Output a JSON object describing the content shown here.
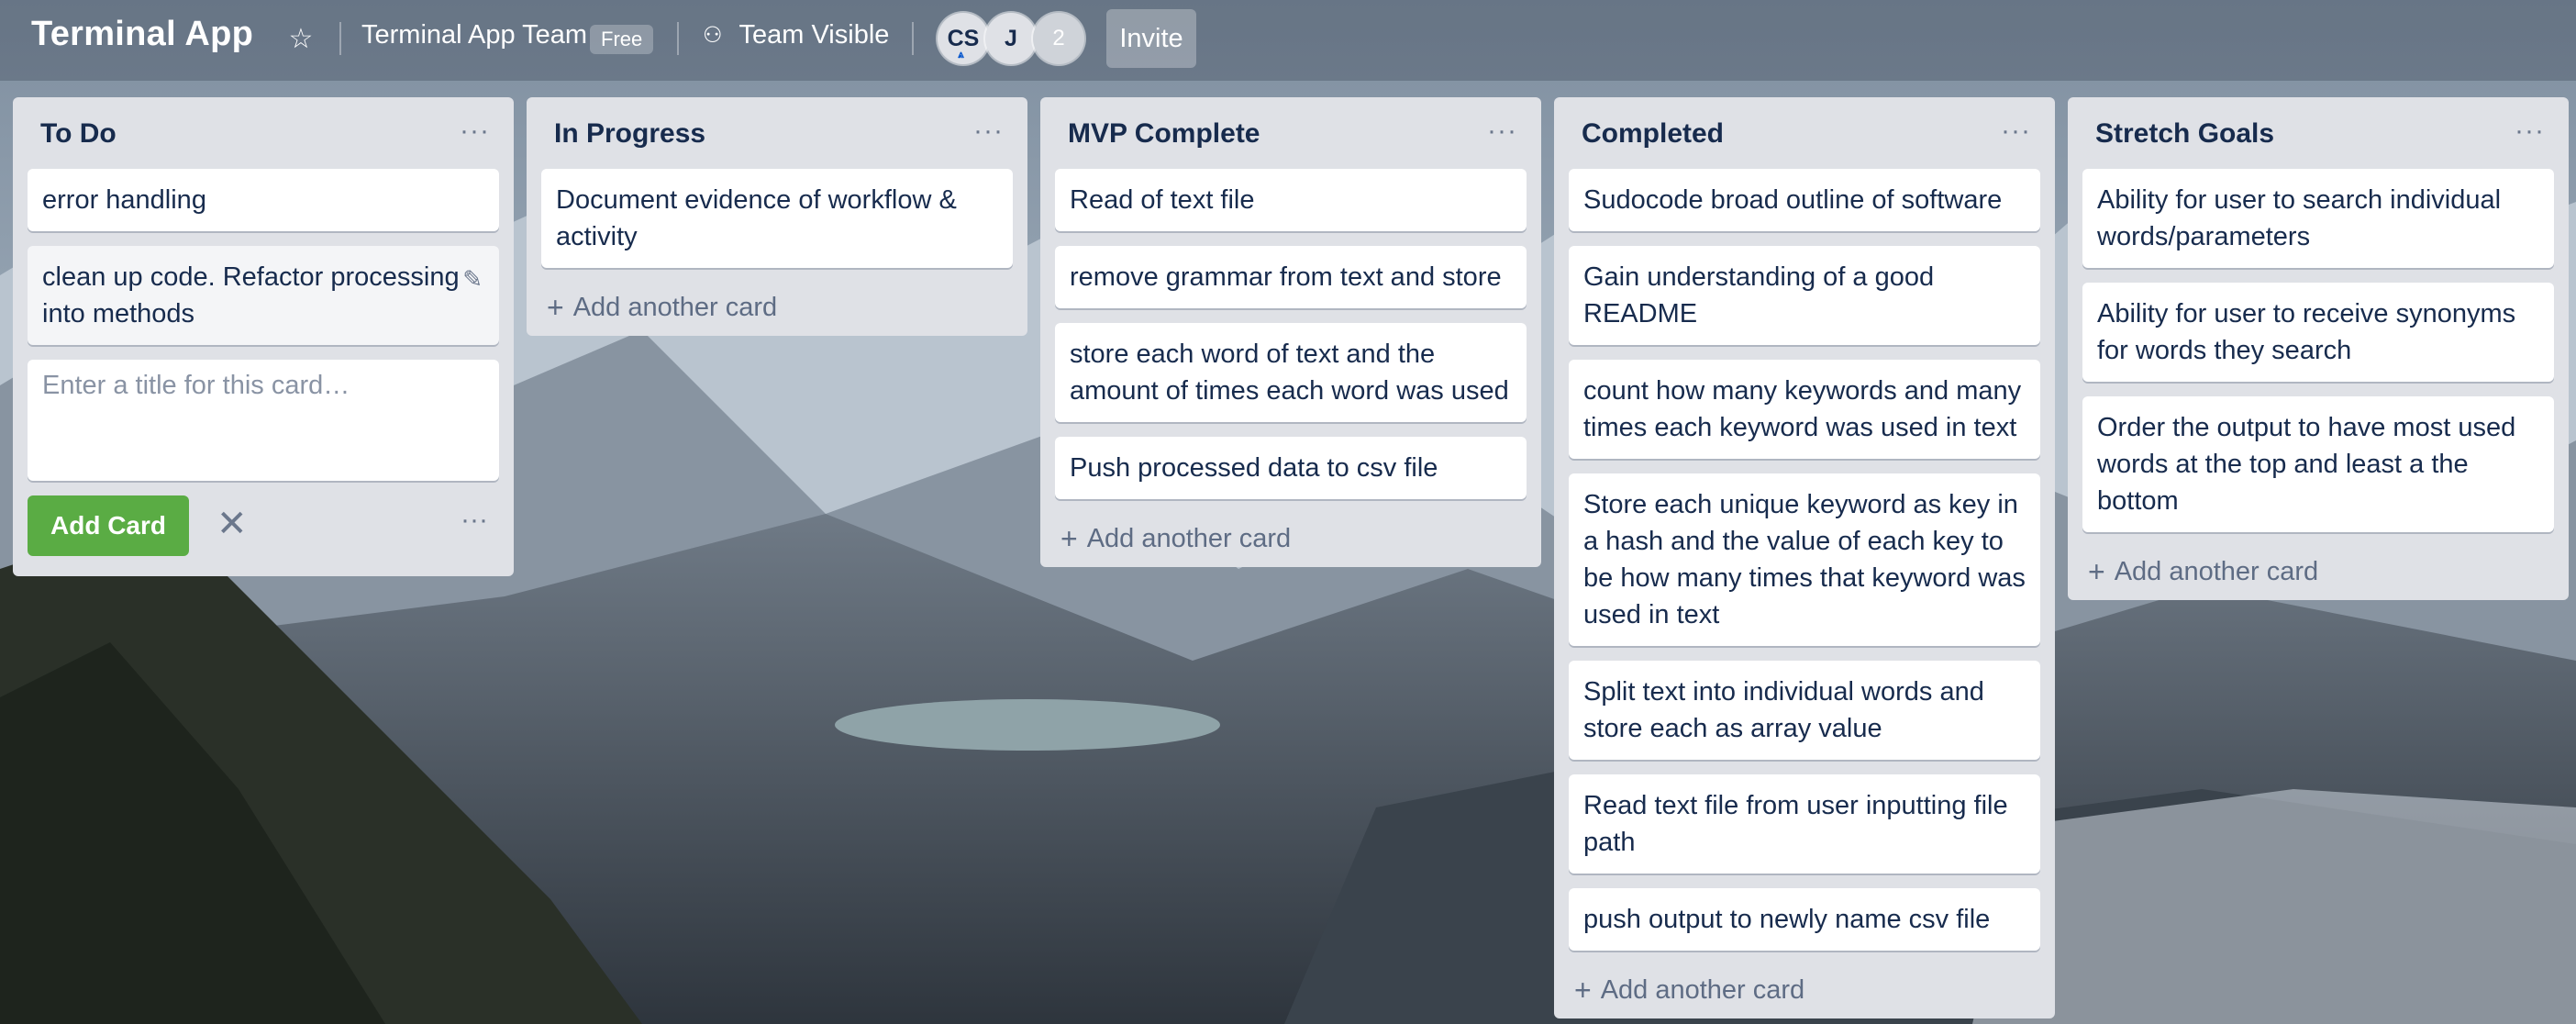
{
  "board": {
    "title": "Terminal App",
    "team": "Terminal App Team",
    "plan_badge": "Free",
    "visibility": "Team Visible",
    "members": [
      "CS",
      "J"
    ],
    "member_overflow": "2",
    "invite_label": "Invite"
  },
  "colors": {
    "list_bg": "#dfe1e6",
    "card_bg": "#ffffff",
    "add_button": "#5aac44",
    "text": "#172b4d"
  },
  "icons": {
    "star": "star-icon",
    "visibility": "team-icon",
    "list_menu": "more-icon",
    "add": "plus-icon",
    "edit": "pencil-icon",
    "close": "close-icon"
  },
  "lists": [
    {
      "title": "To Do",
      "cards": [
        "error handling",
        "clean up code. Refactor processing into methods"
      ],
      "composer_placeholder": "Enter a title for this card…",
      "composer_submit": "Add Card"
    },
    {
      "title": "In Progress",
      "cards": [
        "Document evidence of workflow & activity"
      ],
      "add_label": "Add another card"
    },
    {
      "title": "MVP Complete",
      "cards": [
        "Read of text file",
        "remove grammar from text and store",
        "store each word of text and the amount of times each word was used",
        "Push processed data to csv file"
      ],
      "add_label": "Add another card"
    },
    {
      "title": "Completed",
      "cards": [
        "Sudocode broad outline of software",
        "Gain understanding of a good README",
        "count how many keywords and many times each keyword was used in text",
        "Store each unique keyword as key in a hash and the value of each key to be how many times that keyword was used in text",
        "Split text into individual words and store each as array value",
        "Read text file from user inputting file path",
        "push output to newly name csv file"
      ],
      "add_label": "Add another card"
    },
    {
      "title": "Stretch Goals",
      "cards": [
        "Ability for user to search individual words/parameters",
        "Ability for user to receive synonyms for words they search",
        "Order the output to have most used words at the top and least a the bottom"
      ],
      "add_label": "Add another card"
    }
  ]
}
